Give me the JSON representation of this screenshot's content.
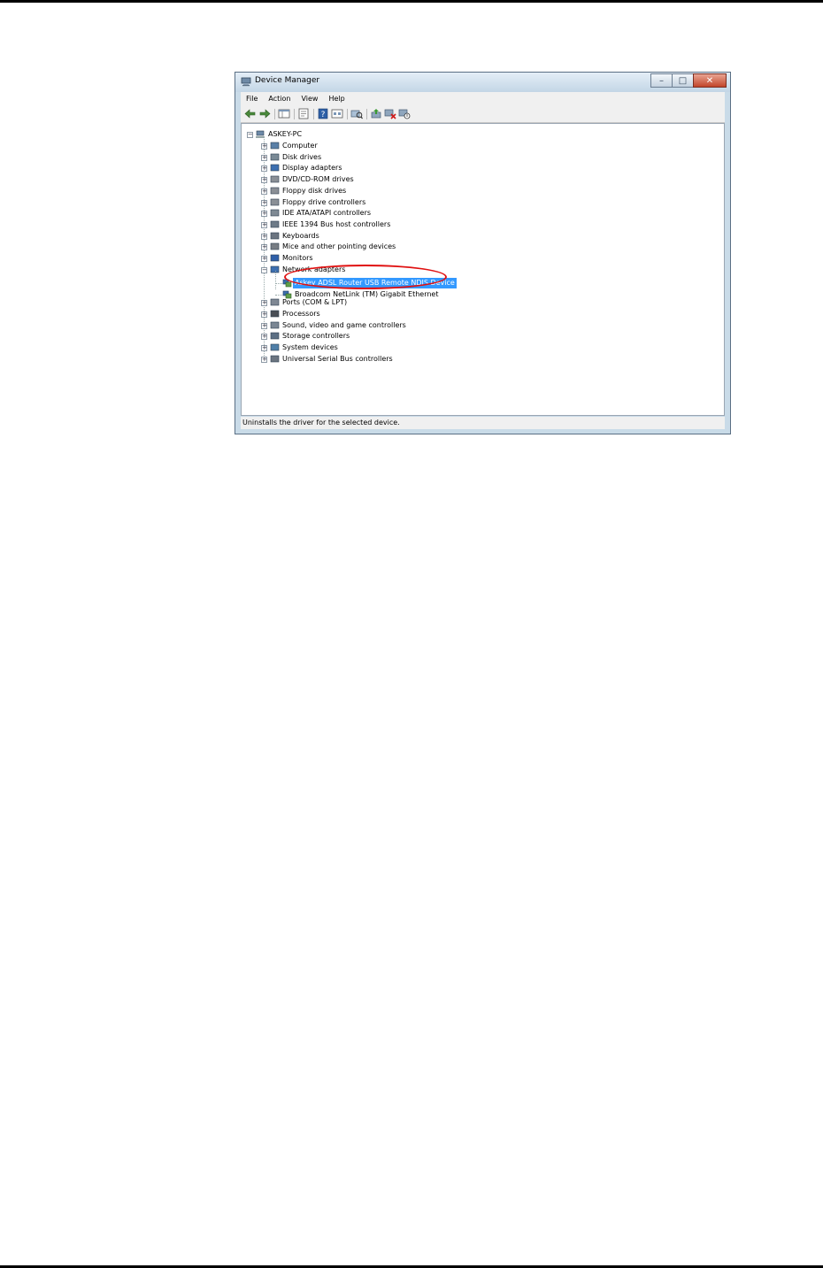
{
  "window": {
    "title": "Device Manager",
    "controls": {
      "minimize": "–",
      "maximize": "□",
      "close": "✕"
    }
  },
  "menu": [
    "File",
    "Action",
    "View",
    "Help"
  ],
  "toolbar": {
    "icons": [
      "back-icon",
      "forward-icon",
      "show-hide-console-tree-icon",
      "properties-icon",
      "help-icon",
      "view-icon",
      "scan-hardware-icon",
      "update-driver-icon",
      "uninstall-icon",
      "disable-icon"
    ]
  },
  "tree": {
    "root": "ASKEY-PC",
    "categories": [
      {
        "label": "Computer",
        "expanded": false
      },
      {
        "label": "Disk drives",
        "expanded": false
      },
      {
        "label": "Display adapters",
        "expanded": false
      },
      {
        "label": "DVD/CD-ROM drives",
        "expanded": false
      },
      {
        "label": "Floppy disk drives",
        "expanded": false
      },
      {
        "label": "Floppy drive controllers",
        "expanded": false
      },
      {
        "label": "IDE ATA/ATAPI controllers",
        "expanded": false
      },
      {
        "label": "IEEE 1394 Bus host controllers",
        "expanded": false
      },
      {
        "label": "Keyboards",
        "expanded": false
      },
      {
        "label": "Mice and other pointing devices",
        "expanded": false
      },
      {
        "label": "Monitors",
        "expanded": false
      },
      {
        "label": "Network adapters",
        "expanded": true
      },
      {
        "label": "Ports (COM & LPT)",
        "expanded": false
      },
      {
        "label": "Processors",
        "expanded": false
      },
      {
        "label": "Sound, video and game controllers",
        "expanded": false
      },
      {
        "label": "Storage controllers",
        "expanded": false
      },
      {
        "label": "System devices",
        "expanded": false
      },
      {
        "label": "Universal Serial Bus controllers",
        "expanded": false
      }
    ],
    "network_children": [
      {
        "label": "Askey ADSL Router USB Remote NDIS Device",
        "selected": true
      },
      {
        "label": "Broadcom NetLink (TM) Gigabit Ethernet",
        "selected": false
      }
    ]
  },
  "status_bar": "Uninstalls the driver for the selected device.",
  "colors": {
    "selection": "#3399ff",
    "highlight_ring": "#e01010"
  }
}
